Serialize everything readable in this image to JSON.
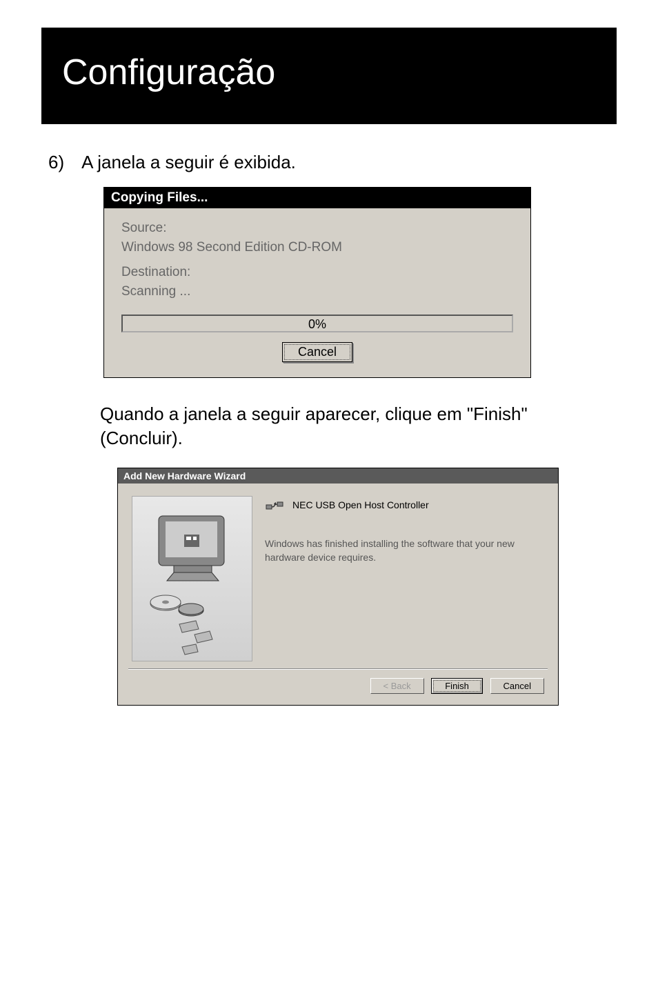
{
  "header": {
    "title": "Configuração"
  },
  "step": {
    "number": "6)",
    "text": "A janela a seguir é exibida."
  },
  "copying_dialog": {
    "title": "Copying Files...",
    "source_label": "Source:",
    "source_value": "Windows 98 Second Edition CD-ROM",
    "dest_label": "Destination:",
    "dest_value": "Scanning ...",
    "progress": "0%",
    "cancel_label": "Cancel"
  },
  "instruction": "Quando a janela a seguir aparecer, clique em \"Finish\" (Concluir).",
  "wizard": {
    "title": "Add New Hardware Wizard",
    "device_name": "NEC USB Open Host Controller",
    "finished_text": "Windows has finished installing the software that your new hardware device requires.",
    "back_label": "< Back",
    "finish_label": "Finish",
    "cancel_label": "Cancel"
  }
}
